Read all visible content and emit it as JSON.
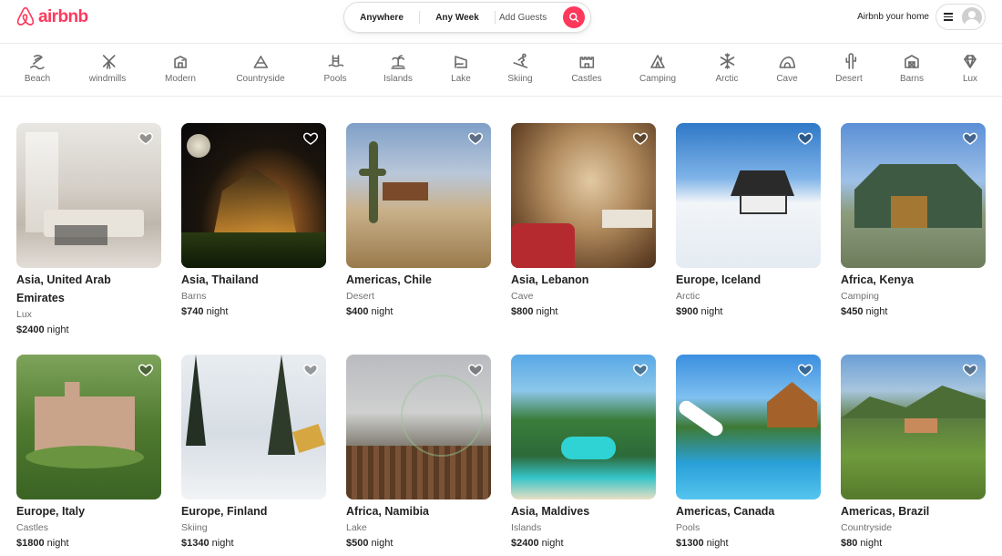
{
  "brand": {
    "name": "airbnb",
    "accent": "#ff385c"
  },
  "search": {
    "where": "Anywhere",
    "when": "Any Week",
    "guests": "Add Guests"
  },
  "header": {
    "host_link": "Airbnb your home"
  },
  "categories": [
    {
      "label": "Beach",
      "icon": "beach-icon"
    },
    {
      "label": "windmills",
      "icon": "windmill-icon"
    },
    {
      "label": "Modern",
      "icon": "modern-house-icon"
    },
    {
      "label": "Countryside",
      "icon": "countryside-icon"
    },
    {
      "label": "Pools",
      "icon": "pool-icon"
    },
    {
      "label": "Islands",
      "icon": "island-icon"
    },
    {
      "label": "Lake",
      "icon": "lake-icon"
    },
    {
      "label": "Skiing",
      "icon": "skiing-icon"
    },
    {
      "label": "Castles",
      "icon": "castle-icon"
    },
    {
      "label": "Camping",
      "icon": "camping-icon"
    },
    {
      "label": "Arctic",
      "icon": "snowflake-icon"
    },
    {
      "label": "Cave",
      "icon": "cave-icon"
    },
    {
      "label": "Desert",
      "icon": "cactus-icon"
    },
    {
      "label": "Barns",
      "icon": "barn-icon"
    },
    {
      "label": "Lux",
      "icon": "diamond-icon"
    }
  ],
  "listings": [
    {
      "location": "Asia, United Arab Emirates",
      "category": "Lux",
      "price": "$2400",
      "unit": "night"
    },
    {
      "location": "Asia, Thailand",
      "category": "Barns",
      "price": "$740",
      "unit": "night"
    },
    {
      "location": "Americas, Chile",
      "category": "Desert",
      "price": "$400",
      "unit": "night"
    },
    {
      "location": "Asia, Lebanon",
      "category": "Cave",
      "price": "$800",
      "unit": "night"
    },
    {
      "location": "Europe, Iceland",
      "category": "Arctic",
      "price": "$900",
      "unit": "night"
    },
    {
      "location": "Africa, Kenya",
      "category": "Camping",
      "price": "$450",
      "unit": "night"
    },
    {
      "location": "Europe, Italy",
      "category": "Castles",
      "price": "$1800",
      "unit": "night"
    },
    {
      "location": "Europe, Finland",
      "category": "Skiing",
      "price": "$1340",
      "unit": "night"
    },
    {
      "location": "Africa, Namibia",
      "category": "Lake",
      "price": "$500",
      "unit": "night"
    },
    {
      "location": "Asia, Maldives",
      "category": "Islands",
      "price": "$2400",
      "unit": "night"
    },
    {
      "location": "Americas, Canada",
      "category": "Pools",
      "price": "$1300",
      "unit": "night"
    },
    {
      "location": "Americas, Brazil",
      "category": "Countryside",
      "price": "$80",
      "unit": "night"
    }
  ]
}
